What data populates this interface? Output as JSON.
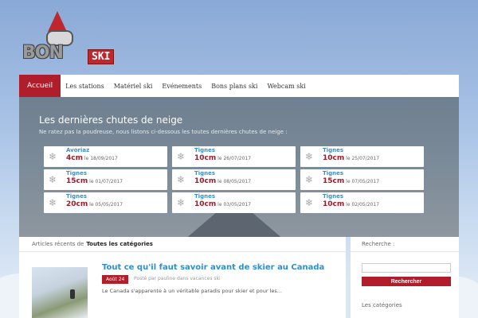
{
  "logo": {
    "text": "BON",
    "badge": "SKI"
  },
  "nav": {
    "items": [
      {
        "label": "Accueil",
        "active": true
      },
      {
        "label": "Les stations"
      },
      {
        "label": "Matériel ski"
      },
      {
        "label": "Evénements"
      },
      {
        "label": "Bons plans ski"
      },
      {
        "label": "Webcam ski"
      }
    ]
  },
  "hero": {
    "title": "Les dernières chutes de neige",
    "subtitle": "Ne ratez pas la poudreuse, nous listons ci-dessous les toutes dernières chutes de neige :",
    "date_prefix": "le",
    "snowfalls": [
      {
        "station": "Avoriaz",
        "depth": "4cm",
        "date": "18/09/2017"
      },
      {
        "station": "Tignes",
        "depth": "10cm",
        "date": "26/07/2017"
      },
      {
        "station": "Tignes",
        "depth": "10cm",
        "date": "25/07/2017"
      },
      {
        "station": "Tignes",
        "depth": "15cm",
        "date": "01/07/2017"
      },
      {
        "station": "Tignes",
        "depth": "10cm",
        "date": "08/05/2017"
      },
      {
        "station": "Tignes",
        "depth": "15cm",
        "date": "07/05/2017"
      },
      {
        "station": "Tignes",
        "depth": "20cm",
        "date": "05/05/2017"
      },
      {
        "station": "Tignes",
        "depth": "10cm",
        "date": "03/05/2017"
      },
      {
        "station": "Tignes",
        "depth": "10cm",
        "date": "02/05/2017"
      }
    ]
  },
  "content": {
    "head_prefix": "Articles récents de",
    "head_strong": "Toutes les catégories",
    "article": {
      "title": "Tout ce qu'il faut savoir avant de skier au Canada",
      "date": "Août 24",
      "meta": "Posté par pauline dans vacances ski",
      "excerpt": "Le Canada s'apparente à un véritable paradis pour skier et pour les..."
    }
  },
  "sidebar": {
    "search_label": "Recherche :",
    "search_value": "",
    "search_button": "Rechercher",
    "categories_label": "Les catégories"
  }
}
